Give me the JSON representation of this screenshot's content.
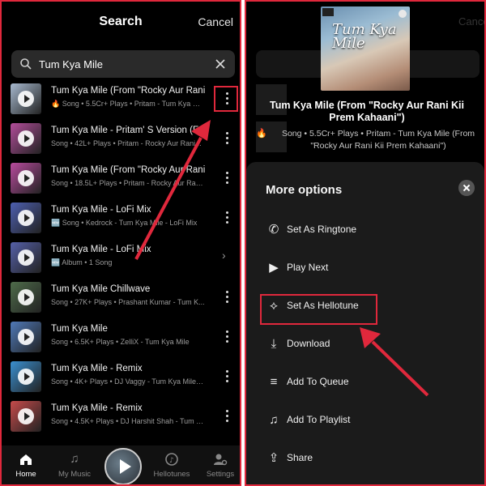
{
  "left": {
    "title": "Search",
    "cancel_label": "Cancel",
    "search": {
      "value": "Tum Kya Mile"
    },
    "results": [
      {
        "title": "Tum Kya Mile (From \"Rocky Aur Rani",
        "subtitle": "🔥 Song • 5.5Cr+ Plays • Pritam - Tum Kya Mi...",
        "action": "more",
        "thumb_color": "#a7b9cf"
      },
      {
        "title": "Tum Kya Mile - Pritam' S Version (Fro",
        "subtitle": "Song • 42L+ Plays • Pritam - Rocky Aur Rani...",
        "action": "more",
        "thumb_color": "#b24d9a"
      },
      {
        "title": "Tum Kya Mile (From \"Rocky Aur Rani",
        "subtitle": "Song • 18.5L+ Plays • Pritam - Rocky Aur Rani...",
        "action": "more",
        "thumb_color": "#b84b9d"
      },
      {
        "title": "Tum Kya Mile - LoFi Mix",
        "subtitle": "🆕 Song • Kedrock - Tum Kya Mile - LoFi Mix",
        "action": "more",
        "thumb_color": "#4d5fb0"
      },
      {
        "title": "Tum Kya Mile - LoFi Mix",
        "subtitle": "🆕 Album • 1 Song",
        "action": "chevron",
        "thumb_color": "#5560a8"
      },
      {
        "title": "Tum Kya Mile Chillwave",
        "subtitle": "Song • 27K+ Plays • Prashant Kumar - Tum K...",
        "action": "more",
        "thumb_color": "#4e6b4a"
      },
      {
        "title": "Tum Kya Mile",
        "subtitle": "Song • 6.5K+ Plays • ZelliX - Tum Kya Mile",
        "action": "more",
        "thumb_color": "#4f79b8"
      },
      {
        "title": "Tum Kya Mile - Remix",
        "subtitle": "Song • 4K+ Plays • DJ Vaggy - Tum Kya Mile -...",
        "action": "more",
        "thumb_color": "#3a8fd0"
      },
      {
        "title": "Tum Kya Mile - Remix",
        "subtitle": "Song • 4.5K+ Plays • DJ Harshit Shah - Tum K...",
        "action": "more",
        "thumb_color": "#c64b4b"
      }
    ],
    "nav": [
      {
        "label": "Home",
        "icon": "home-icon",
        "active": true
      },
      {
        "label": "My Music",
        "icon": "music-note-icon",
        "active": false
      },
      {
        "label": "Hellotunes",
        "icon": "hellotunes-icon",
        "active": false
      },
      {
        "label": "Settings",
        "icon": "settings-icon",
        "active": false
      }
    ]
  },
  "right": {
    "album_title": "Tum Kya Mile",
    "song_title": "Tum Kya Mile (From \"Rocky Aur Rani Kii Prem Kahaani\")",
    "song_info": "Song • 5.5Cr+ Plays • Pritam - Tum Kya Mile (From \"Rocky Aur Rani Kii Prem Kahaani\")",
    "sheet_title": "More options",
    "options": [
      {
        "label": "Set As Ringtone",
        "icon": "ringtone-icon"
      },
      {
        "label": "Play Next",
        "icon": "play-next-icon"
      },
      {
        "label": "Set As Hellotune",
        "icon": "hellotune-icon"
      },
      {
        "label": "Download",
        "icon": "download-icon"
      },
      {
        "label": "Add To Queue",
        "icon": "queue-icon"
      },
      {
        "label": "Add To Playlist",
        "icon": "playlist-add-icon"
      },
      {
        "label": "Share",
        "icon": "share-icon"
      }
    ]
  },
  "colors": {
    "highlight": "#e0283c",
    "background": "#000000",
    "sheet": "#1b1b1b"
  }
}
